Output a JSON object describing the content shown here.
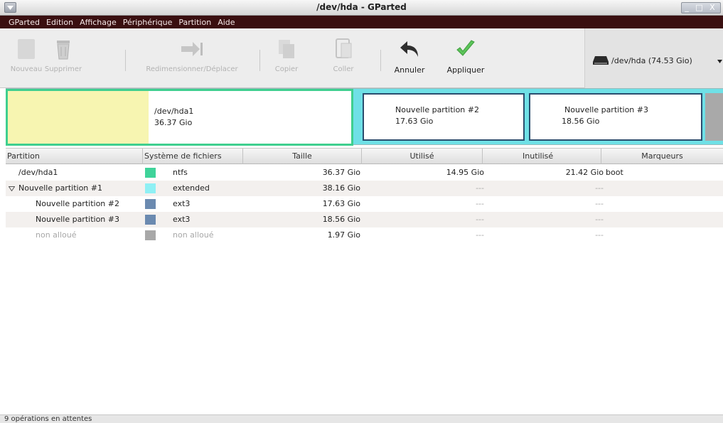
{
  "window": {
    "title": "/dev/hda - GParted",
    "controls": "_ □ X"
  },
  "menu": [
    "GParted",
    "Edition",
    "Affichage",
    "Périphérique",
    "Partition",
    "Aide"
  ],
  "toolbar": {
    "new": "Nouveau",
    "delete": "Supprimer",
    "resize": "Redimensionner/Déplacer",
    "copy": "Copier",
    "paste": "Coller",
    "undo": "Annuler",
    "apply": "Appliquer",
    "device": "/dev/hda  (74.53 Gio)"
  },
  "partition_map": {
    "p1": {
      "name": "/dev/hda1",
      "size": "36.37 Gio",
      "used_fraction": 0.41
    },
    "p2": {
      "name": "Nouvelle partition #2",
      "size": "17.63 Gio"
    },
    "p3": {
      "name": "Nouvelle partition #3",
      "size": "18.56 Gio"
    }
  },
  "table": {
    "headers": [
      "Partition",
      "Système de fichiers",
      "Taille",
      "Utilisé",
      "Inutilisé",
      "Marqueurs"
    ],
    "rows": [
      {
        "partition": "/dev/hda1",
        "fs": "ntfs",
        "color": "#3fd39a",
        "size": "36.37 Gio",
        "used": "14.95 Gio",
        "unused": "21.42 Gio",
        "flags": "boot"
      },
      {
        "partition": "Nouvelle partition #1",
        "fs": "extended",
        "color": "#8ff0f4",
        "size": "38.16 Gio",
        "used": "---",
        "unused": "---",
        "flags": ""
      },
      {
        "partition": "Nouvelle partition #2",
        "fs": "ext3",
        "color": "#6b8ab0",
        "size": "17.63 Gio",
        "used": "---",
        "unused": "---",
        "flags": ""
      },
      {
        "partition": "Nouvelle partition #3",
        "fs": "ext3",
        "color": "#6b8ab0",
        "size": "18.56 Gio",
        "used": "---",
        "unused": "---",
        "flags": ""
      },
      {
        "partition": "non alloué",
        "fs": "non alloué",
        "color": "#a8a8a8",
        "size": "1.97 Gio",
        "used": "---",
        "unused": "---",
        "flags": ""
      }
    ]
  },
  "status": "9 opérations en attentes"
}
